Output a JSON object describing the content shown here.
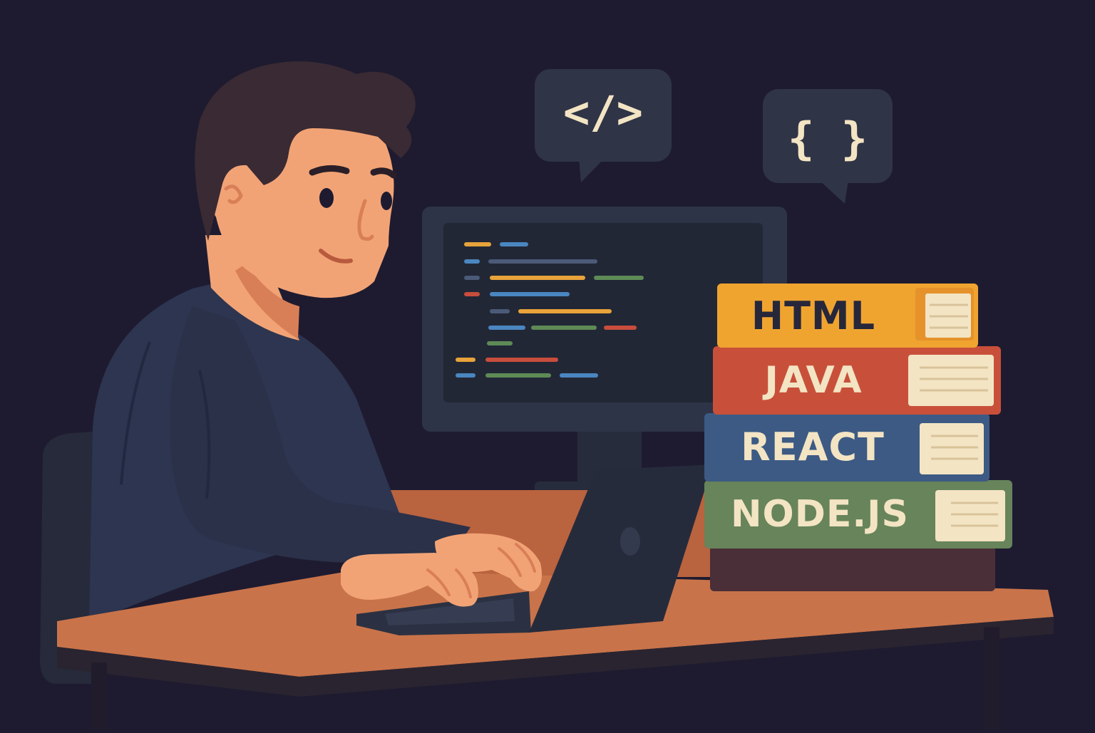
{
  "colors": {
    "background": "#1e1b30",
    "sweater": "#2d3550",
    "skin": "#f2a375",
    "hair": "#3a2a33",
    "desk": "#c9734a",
    "monitor": "#2e3447",
    "laptop": "#262b3b",
    "bubble": "#2f3446",
    "bubble_text": "#f3e4c4"
  },
  "bubbles": {
    "tag": {
      "text": "</>",
      "icon": "code-tag-icon"
    },
    "braces": {
      "text": "{ }",
      "icon": "curly-braces-icon"
    }
  },
  "books": [
    {
      "label": "HTML",
      "cover": "#f0a430",
      "spine": "#e6922a",
      "text_color": "#26273a"
    },
    {
      "label": "JAVA",
      "cover": "#c8503a",
      "spine": "#b8432f",
      "text_color": "#f3e4c4"
    },
    {
      "label": "REACT",
      "cover": "#3c5a84",
      "spine": "#34507a",
      "text_color": "#f3e4c4"
    },
    {
      "label": "NODE.JS",
      "cover": "#67845a",
      "spine": "#5c7850",
      "text_color": "#f3e4c4"
    }
  ]
}
